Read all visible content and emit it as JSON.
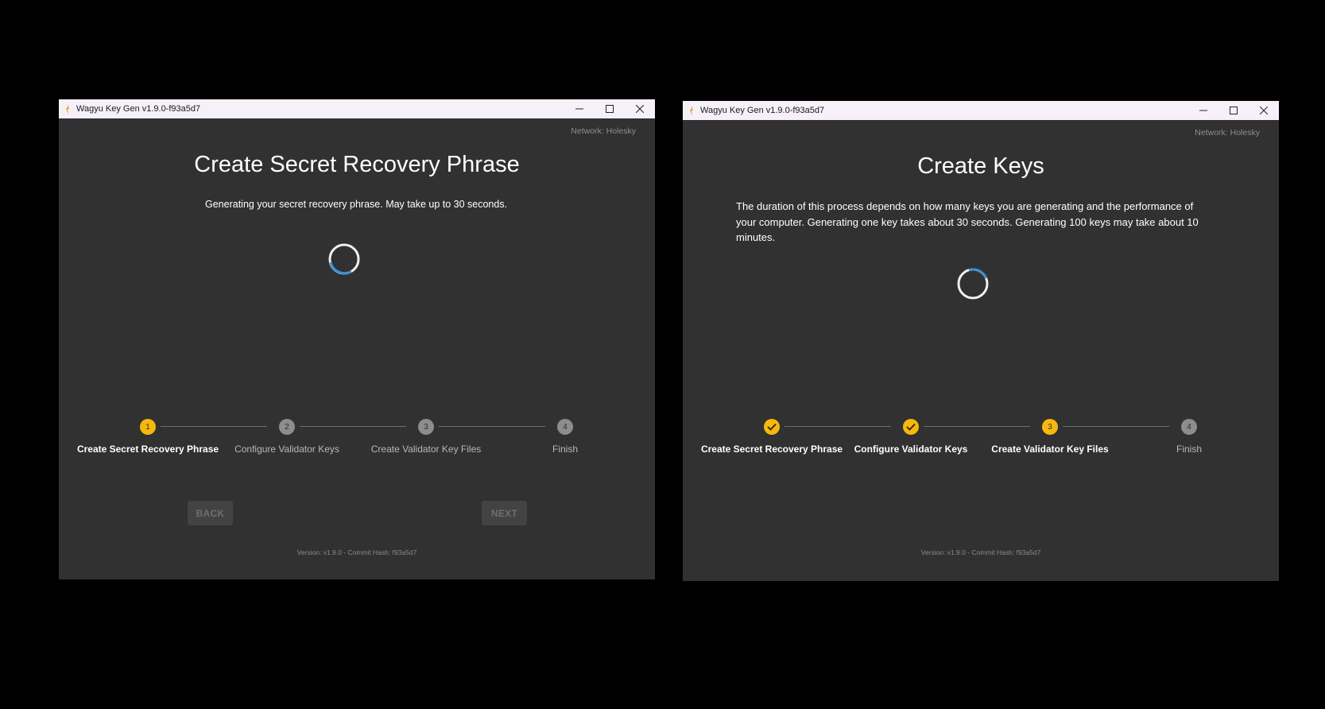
{
  "window1": {
    "title": "Wagyu Key Gen v1.9.0-f93a5d7",
    "network": "Network: Holesky",
    "heading": "Create Secret Recovery Phrase",
    "message": "Generating your secret recovery phrase. May take up to 30 seconds.",
    "steps": [
      {
        "number": "1",
        "label": "Create Secret Recovery Phrase"
      },
      {
        "number": "2",
        "label": "Configure Validator Keys"
      },
      {
        "number": "3",
        "label": "Create Validator Key Files"
      },
      {
        "number": "4",
        "label": "Finish"
      }
    ],
    "back_label": "BACK",
    "next_label": "NEXT",
    "version": "Version: v1.9.0 - Commit Hash: f93a5d7"
  },
  "window2": {
    "title": "Wagyu Key Gen v1.9.0-f93a5d7",
    "network": "Network: Holesky",
    "heading": "Create Keys",
    "message": "The duration of this process depends on how many keys you are generating and the performance of your computer. Generating one key takes about 30 seconds. Generating 100 keys may take about 10 minutes.",
    "steps": [
      {
        "number": "",
        "label": "Create Secret Recovery Phrase"
      },
      {
        "number": "",
        "label": "Configure Validator Keys"
      },
      {
        "number": "3",
        "label": "Create Validator Key Files"
      },
      {
        "number": "4",
        "label": "Finish"
      }
    ],
    "version": "Version: v1.9.0 - Commit Hash: f93a5d7"
  },
  "colors": {
    "accent": "#f6b80f",
    "spinner": "#3a8fd9",
    "background": "#313131"
  }
}
